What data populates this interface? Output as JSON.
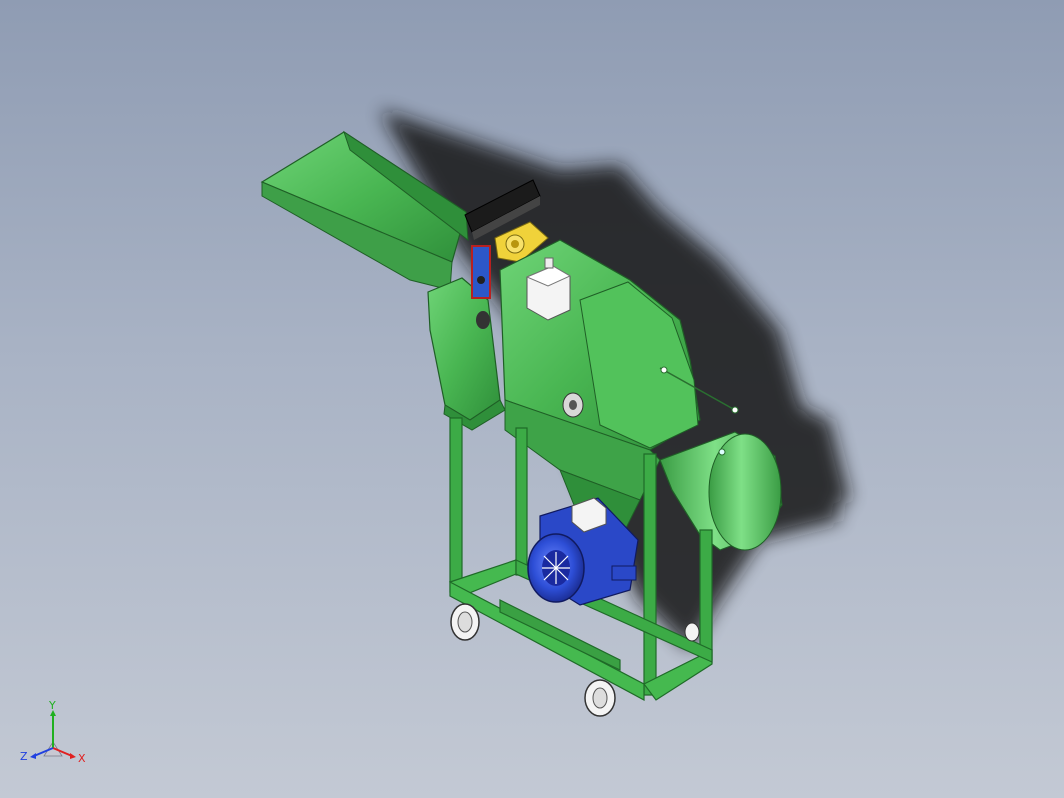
{
  "viewport": {
    "background_top": "#8f9cb3",
    "background_bottom": "#c3c9d4"
  },
  "model": {
    "body_color": "#4cbb55",
    "body_dark": "#2f8f3a",
    "motor_color": "#2f4fd8",
    "shadow_color": "#1c1c1c"
  },
  "triad": {
    "x_label": "X",
    "y_label": "Y",
    "z_label": "Z",
    "x_color": "#e02020",
    "y_color": "#20b020",
    "z_color": "#2040e0"
  }
}
